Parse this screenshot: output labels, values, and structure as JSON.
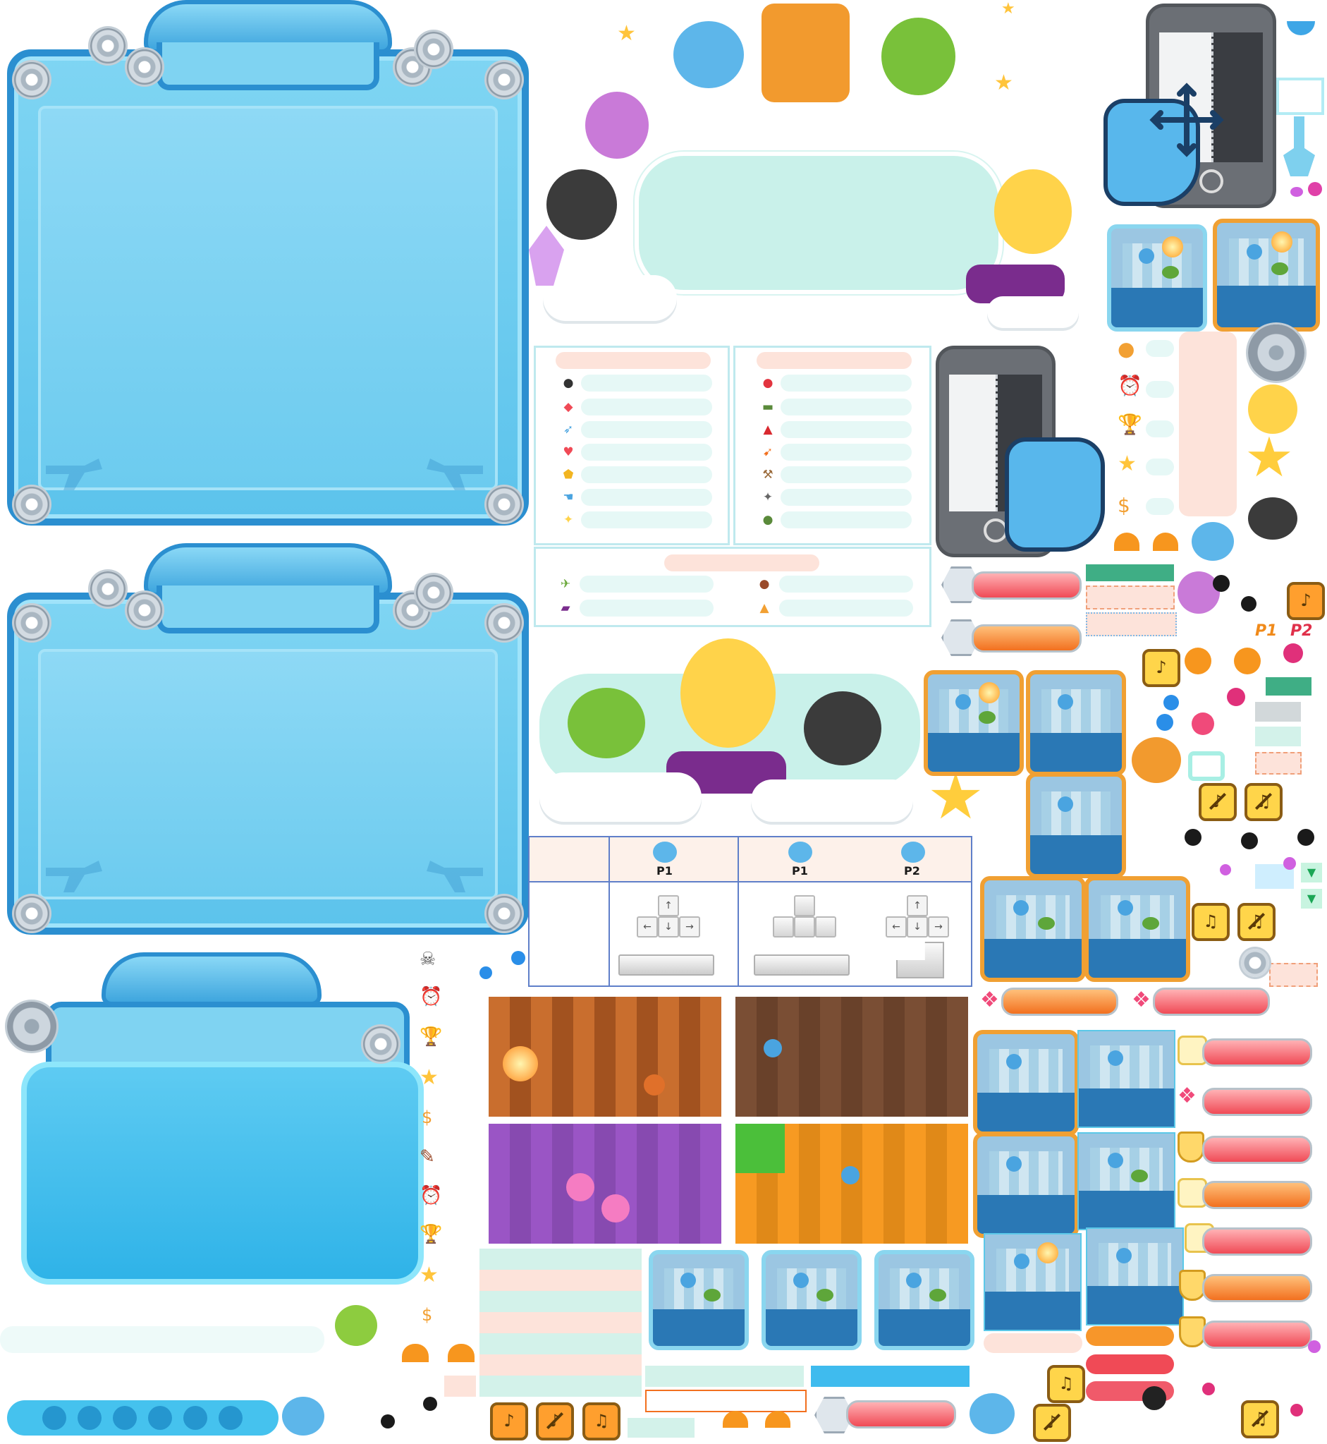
{
  "sheet": {
    "player_labels": {
      "p1": "P1",
      "p2": "P2"
    },
    "key_table": {
      "p1_label": "P1",
      "p2_label": "P2",
      "arrow_keys": {
        "up": "↑",
        "left": "←",
        "down": "↓",
        "right": "→"
      }
    },
    "sound_button_icons": [
      "speaker-icon",
      "speaker-muted-icon",
      "music-icon",
      "music-muted-icon"
    ],
    "colors": {
      "frame_blue": "#2b8fd0",
      "frame_fill": "#7fd5f3",
      "mint": "#c9f1ea",
      "peach": "#fde3da",
      "orange": "#f2a033",
      "pink": "#f04a7a",
      "bar_red": "#f04a56"
    }
  }
}
